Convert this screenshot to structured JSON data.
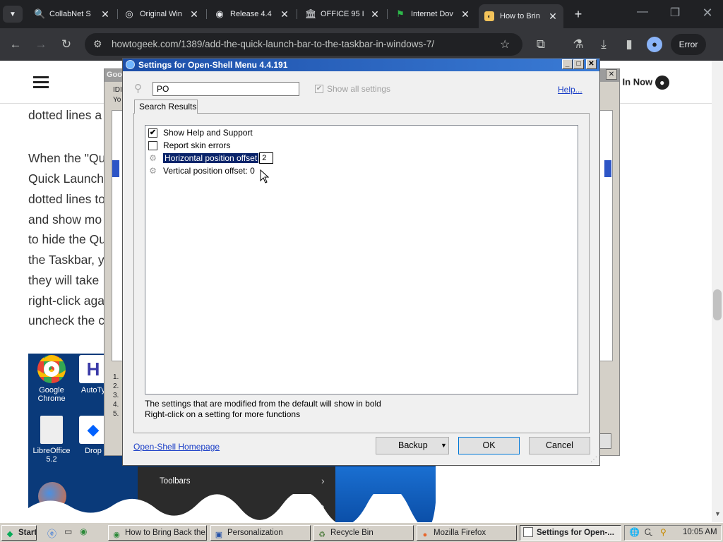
{
  "browser": {
    "tabs": [
      {
        "label": "CollabNet S",
        "icon": "search-icon",
        "active": false
      },
      {
        "label": "Original Win",
        "icon": "globe-icon",
        "active": false
      },
      {
        "label": "Release 4.4",
        "icon": "github-icon",
        "active": false
      },
      {
        "label": "OFFICE 95 I",
        "icon": "archive-icon",
        "active": false
      },
      {
        "label": "Internet Dov",
        "icon": "flag-icon",
        "active": false
      },
      {
        "label": "How to Brin",
        "icon": "htg-icon",
        "active": true
      }
    ],
    "new_tab": "+",
    "url": "howtogeek.com/1389/add-the-quick-launch-bar-to-the-taskbar-in-windows-7/",
    "error_label": "Error"
  },
  "site": {
    "sign_in": "n In Now",
    "article_lines": [
      "dotted lines a",
      "When the \"Qu",
      "Quick Launch",
      "dotted lines to",
      "and show mo",
      "to hide the Qu",
      "the Taskbar, y",
      "they will take",
      "right-click aga",
      "uncheck the c"
    ]
  },
  "desktop": {
    "icons": [
      {
        "label": "Google Chrome"
      },
      {
        "label": "AutoTy"
      },
      {
        "label": "LibreOffice 5.2"
      },
      {
        "label": "Drop"
      }
    ],
    "context_menu_item": "Toolbars"
  },
  "background_window": {
    "title": "Goo",
    "snippet_1": "IDI",
    "snippet_2": "Yo",
    "list": [
      "1.",
      "2.",
      "3.",
      "4.",
      "5."
    ]
  },
  "dialog": {
    "title": "Settings for Open-Shell Menu 4.4.191",
    "search_value": "PO",
    "show_all_label": "Show all settings",
    "help_link": "Help...",
    "tab_label": "Search Results",
    "rows": [
      {
        "label": "Show Help and Support",
        "type": "checkbox",
        "checked": true
      },
      {
        "label": "Report skin errors",
        "type": "checkbox",
        "checked": false
      },
      {
        "label": "Horizontal position offset",
        "type": "setting",
        "edit_value": "2",
        "selected": true
      },
      {
        "label": "Vertical position offset: 0",
        "type": "setting"
      }
    ],
    "hint_1": "The settings that are modified from the default will show in bold",
    "hint_2": "Right-click on a setting for more functions",
    "homepage_link": "Open-Shell Homepage",
    "backup_label": "Backup",
    "ok_label": "OK",
    "cancel_label": "Cancel"
  },
  "taskbar": {
    "start_label": "Start",
    "items": [
      {
        "label": "How to Bring Back the...",
        "icon": "chrome-icon"
      },
      {
        "label": "Personalization",
        "icon": "personalization-icon"
      },
      {
        "label": "Recycle Bin",
        "icon": "recycle-bin-icon"
      },
      {
        "label": "Mozilla Firefox",
        "icon": "firefox-icon"
      },
      {
        "label": "Settings for Open-...",
        "icon": "window-icon",
        "pressed": true
      }
    ],
    "clock": "10:05 AM"
  }
}
